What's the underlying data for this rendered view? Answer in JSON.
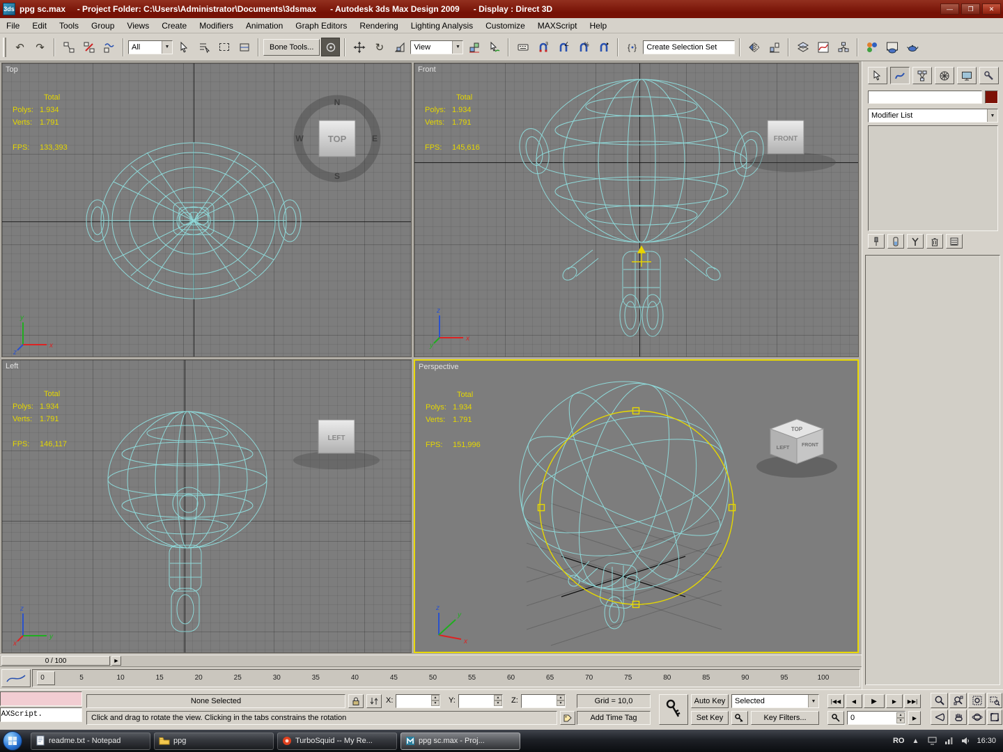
{
  "window": {
    "title": "ppg sc.max     - Project Folder: C:\\Users\\Administrator\\Documents\\3dsmax      - Autodesk 3ds Max Design 2009      - Display : Direct 3D",
    "app_initials": "3ds",
    "minimize": "—",
    "restore": "❐",
    "close": "✕"
  },
  "menu": {
    "items": [
      "File",
      "Edit",
      "Tools",
      "Group",
      "Views",
      "Create",
      "Modifiers",
      "Animation",
      "Graph Editors",
      "Rendering",
      "Lighting Analysis",
      "Customize",
      "MAXScript",
      "Help"
    ]
  },
  "toolbar": {
    "selection_filter_value": "All",
    "bone_tools_label": "Bone Tools...",
    "reference_coordinate_value": "View",
    "named_selection_placeholder": "Create Selection Set",
    "snap_superscript": "3",
    "angle_glyph": "∠",
    "percent_glyph": "%"
  },
  "stats_labels": {
    "total": "Total",
    "polys": "Polys:",
    "verts": "Verts:",
    "fps": "FPS:"
  },
  "viewports": {
    "top": {
      "label": "Top",
      "polys": "1.934",
      "verts": "1.791",
      "fps": "133,393",
      "cube": "TOP"
    },
    "front": {
      "label": "Front",
      "polys": "1.934",
      "verts": "1.791",
      "fps": "145,616",
      "cube": "FRONT"
    },
    "left": {
      "label": "Left",
      "polys": "1.934",
      "verts": "1.791",
      "fps": "146,117",
      "cube": "LEFT"
    },
    "perspective": {
      "label": "Perspective",
      "polys": "1.934",
      "verts": "1.791",
      "fps": "151,996",
      "cube_top": "TOP",
      "cube_left": "LEFT",
      "cube_front": "FRONT"
    }
  },
  "compass": {
    "n": "N",
    "e": "E",
    "s": "S",
    "w": "W"
  },
  "axis": {
    "x": "x",
    "y": "y",
    "z": "z"
  },
  "command_panel": {
    "modifier_list": "Modifier List"
  },
  "time_slider": {
    "handle": "0 / 100"
  },
  "timeline": {
    "ticks": [
      "0",
      "5",
      "10",
      "15",
      "20",
      "25",
      "30",
      "35",
      "40",
      "45",
      "50",
      "55",
      "60",
      "65",
      "70",
      "75",
      "80",
      "85",
      "90",
      "95",
      "100"
    ]
  },
  "status_bar": {
    "maxscript_text": "MAXScript.",
    "selection_status": "None Selected",
    "x_label": "X:",
    "y_label": "Y:",
    "z_label": "Z:",
    "grid_display": "Grid = 10,0",
    "prompt": "Click and drag to rotate the view.  Clicking in the tabs constrains the rotation",
    "add_time_tag": "Add Time Tag",
    "auto_key_label": "Auto Key",
    "set_key_label": "Set Key",
    "key_mode_value": "Selected",
    "key_filters_label": "Key Filters...",
    "frame_value": "0",
    "playback": {
      "go_start": "|◀◀",
      "prev": "◀",
      "play": "▶",
      "next": "▶",
      "go_end": "▶▶|"
    }
  },
  "taskbar": {
    "items": [
      {
        "label": "readme.txt - Notepad"
      },
      {
        "label": "ppg"
      },
      {
        "label": "TurboSquid -- My Re..."
      },
      {
        "label": "ppg sc.max     - Proj..."
      }
    ],
    "language": "RO",
    "clock": "16:30"
  }
}
